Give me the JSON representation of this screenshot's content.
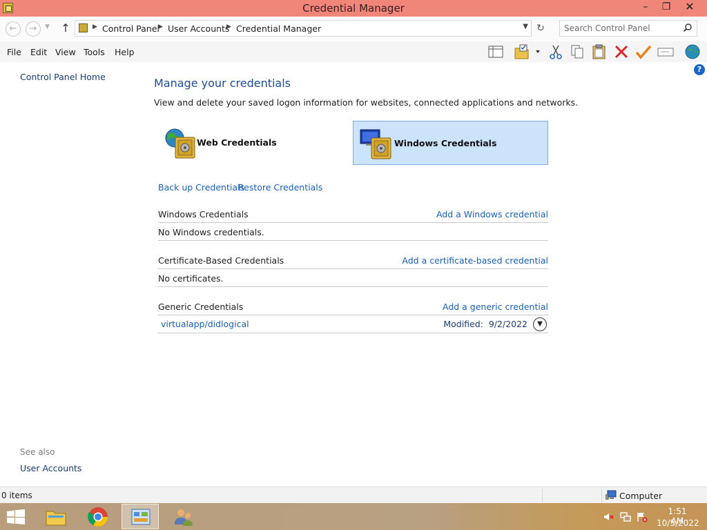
{
  "window": {
    "title": "Credential Manager",
    "controls": {
      "minimize": "–",
      "maximize": "❐",
      "close": "✕"
    }
  },
  "address": {
    "breadcrumb": [
      "Control Panel",
      "User Accounts",
      "Credential Manager"
    ],
    "search_placeholder": "Search Control Panel"
  },
  "menu": [
    "File",
    "Edit",
    "View",
    "Tools",
    "Help"
  ],
  "toolbar_icons": [
    "layout-icon",
    "folder-check-icon",
    "cut-icon",
    "copy-icon",
    "paste-icon",
    "delete-icon",
    "checkmark-icon",
    "properties-icon",
    "globe-icon"
  ],
  "leftnav": {
    "home": "Control Panel Home",
    "see_also_label": "See also",
    "see_also_links": [
      "User Accounts"
    ]
  },
  "main": {
    "title": "Manage your credentials",
    "description": "View and delete your saved logon information for websites, connected applications and networks.",
    "tiles": [
      {
        "label": "Web Credentials",
        "selected": false
      },
      {
        "label": "Windows Credentials",
        "selected": true
      }
    ],
    "backup_link": "Back up Credentials",
    "restore_link": "Restore Credentials",
    "sections": {
      "windows": {
        "header": "Windows Credentials",
        "action": "Add a Windows credential",
        "empty_text": "No Windows credentials."
      },
      "certificate": {
        "header": "Certificate-Based Credentials",
        "action": "Add a certificate-based credential",
        "empty_text": "No certificates."
      },
      "generic": {
        "header": "Generic Credentials",
        "action": "Add a generic credential",
        "items": [
          {
            "name": "virtualapp/didlogical",
            "modified_label": "Modified:",
            "modified_date": "9/2/2022"
          }
        ]
      }
    }
  },
  "statusbar": {
    "items": "0 items",
    "zone": "Computer"
  },
  "taskbar": {
    "apps": [
      "file-explorer-icon",
      "chrome-icon",
      "control-panel-icon",
      "user-accounts-icon"
    ],
    "clock_time": "1:51 AM",
    "clock_date": "10/5/2022"
  },
  "colors": {
    "titlebar": "#f0857a",
    "link": "#1a5fb4",
    "heading": "#1e4a9a",
    "selected_tile": "#cce4fb",
    "help": "#1a66c8"
  }
}
